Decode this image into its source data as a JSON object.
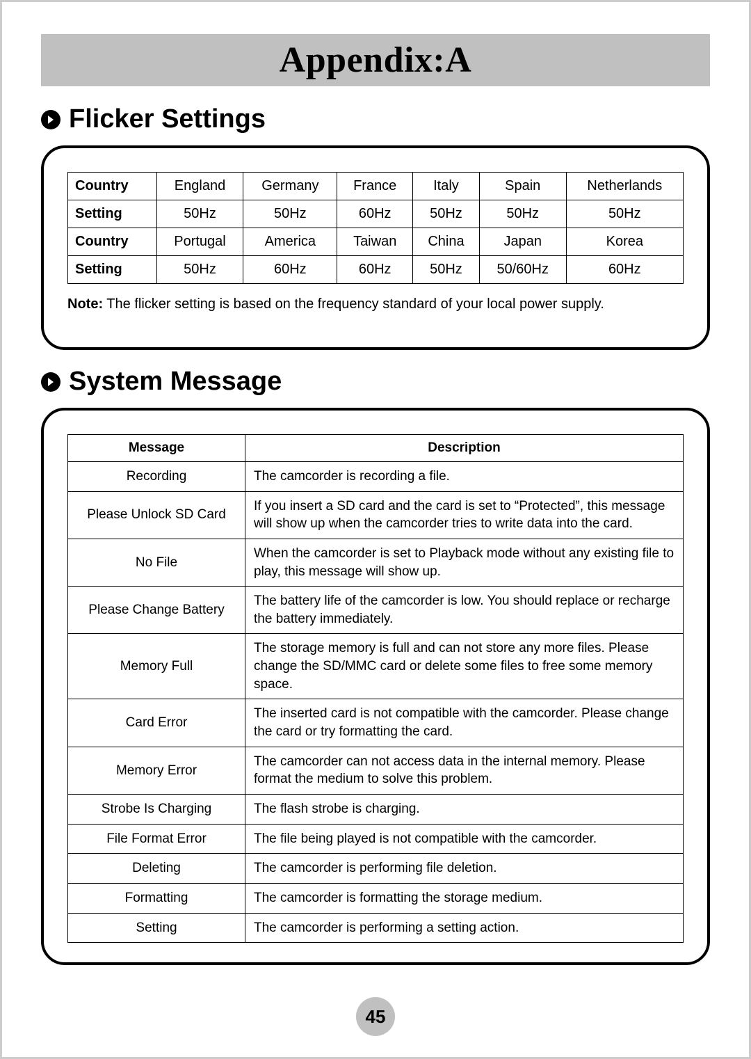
{
  "title": "Appendix:A",
  "sections": {
    "flicker": {
      "heading": "Flicker Settings",
      "labels": {
        "country": "Country",
        "setting": "Setting"
      },
      "row1_countries": [
        "England",
        "Germany",
        "France",
        "Italy",
        "Spain",
        "Netherlands"
      ],
      "row1_settings": [
        "50Hz",
        "50Hz",
        "60Hz",
        "50Hz",
        "50Hz",
        "50Hz"
      ],
      "row2_countries": [
        "Portugal",
        "America",
        "Taiwan",
        "China",
        "Japan",
        "Korea"
      ],
      "row2_settings": [
        "50Hz",
        "60Hz",
        "60Hz",
        "50Hz",
        "50/60Hz",
        "60Hz"
      ],
      "note_label": "Note:",
      "note_text": " The flicker setting is based on the frequency standard of your local power supply."
    },
    "sysmsg": {
      "heading": "System Message",
      "headers": {
        "message": "Message",
        "description": "Description"
      },
      "rows": [
        {
          "message": "Recording",
          "description": "The camcorder is recording a file."
        },
        {
          "message": "Please Unlock SD Card",
          "description": "If you insert a SD card and the card is set to “Protected”, this message will show up when the camcorder tries to write data into the card."
        },
        {
          "message": "No File",
          "description": "When the camcorder is set to Playback mode without any existing file to play, this message will show up."
        },
        {
          "message": "Please Change Battery",
          "description": "The battery life of the camcorder is low. You should replace or recharge the battery immediately."
        },
        {
          "message": "Memory Full",
          "description": "The storage memory is full and can not store any more files. Please change the SD/MMC card or delete some files to free some memory space."
        },
        {
          "message": "Card Error",
          "description": "The inserted card is not compatible with the camcorder. Please change the card or try formatting the card."
        },
        {
          "message": "Memory Error",
          "description": "The camcorder can not access data in the internal memory.\nPlease format the medium to solve this problem."
        },
        {
          "message": "Strobe Is Charging",
          "description": "The flash strobe is charging."
        },
        {
          "message": "File Format Error",
          "description": "The file being played is not compatible with the camcorder."
        },
        {
          "message": "Deleting",
          "description": "The camcorder is performing file deletion."
        },
        {
          "message": "Formatting",
          "description": "The camcorder is formatting the storage medium."
        },
        {
          "message": "Setting",
          "description": "The camcorder is performing a setting action."
        }
      ]
    }
  },
  "page_number": "45"
}
